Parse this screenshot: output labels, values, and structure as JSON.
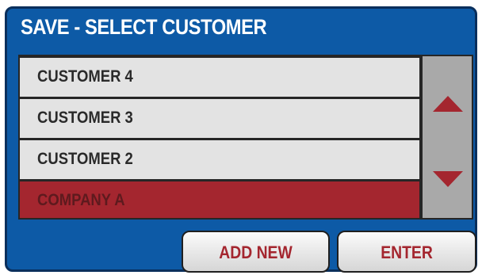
{
  "dialog": {
    "title": "SAVE - SELECT CUSTOMER"
  },
  "customer_list": {
    "items": [
      {
        "label": "CUSTOMER 4",
        "selected": false
      },
      {
        "label": "CUSTOMER 3",
        "selected": false
      },
      {
        "label": "CUSTOMER 2",
        "selected": false
      },
      {
        "label": "COMPANY A",
        "selected": true
      }
    ]
  },
  "scrollbar": {
    "up_icon": "triangle-up-icon",
    "down_icon": "triangle-down-icon"
  },
  "buttons": {
    "add_new_label": "ADD NEW",
    "enter_label": "ENTER"
  },
  "colors": {
    "panel_background": "#0d5aa6",
    "row_background": "#e3e3e3",
    "selected_row": "#a4262f",
    "scroll_track": "#a9a9a9",
    "accent_text": "#a4262f"
  }
}
